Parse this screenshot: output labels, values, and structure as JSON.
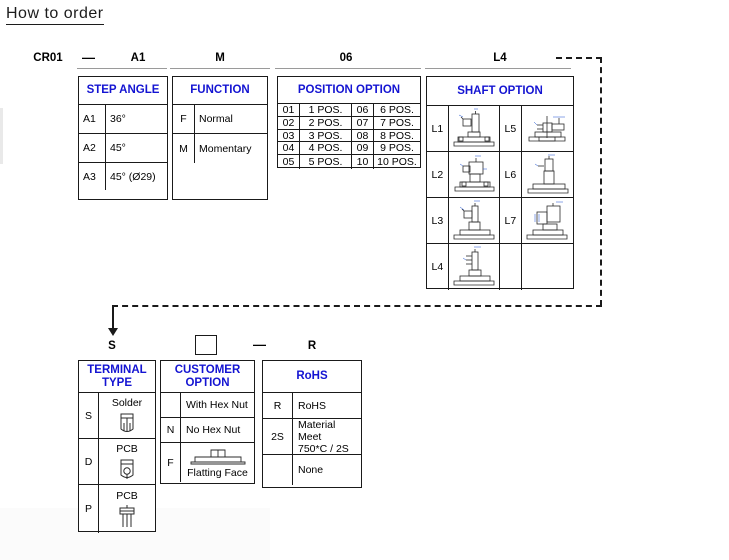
{
  "title": "How to order",
  "part_code": {
    "segments": [
      {
        "name": "series",
        "value": "CR01"
      },
      {
        "name": "step-angle",
        "value": "A1"
      },
      {
        "name": "function",
        "value": "M"
      },
      {
        "name": "position-option",
        "value": "06"
      },
      {
        "name": "shaft-option",
        "value": "L4"
      },
      {
        "name": "terminal-type",
        "value": "S"
      },
      {
        "name": "customer-option",
        "value": ""
      },
      {
        "name": "rohs",
        "value": "R"
      }
    ],
    "separator": "—"
  },
  "tables": {
    "step_angle": {
      "header": "STEP ANGLE",
      "rows": [
        {
          "code": "A1",
          "desc": "36°"
        },
        {
          "code": "A2",
          "desc": "45°"
        },
        {
          "code": "A3",
          "desc": "45° (Ø29)"
        }
      ]
    },
    "function": {
      "header": "FUNCTION",
      "rows": [
        {
          "code": "F",
          "desc": "Normal"
        },
        {
          "code": "M",
          "desc": "Momentary"
        }
      ]
    },
    "position_option": {
      "header": "POSITION OPTION",
      "rows": [
        {
          "code_l": "01",
          "desc_l": "1 POS.",
          "code_r": "06",
          "desc_r": "6 POS."
        },
        {
          "code_l": "02",
          "desc_l": "2 POS.",
          "code_r": "07",
          "desc_r": "7 POS."
        },
        {
          "code_l": "03",
          "desc_l": "3 POS.",
          "code_r": "08",
          "desc_r": "8 POS."
        },
        {
          "code_l": "04",
          "desc_l": "4 POS.",
          "code_r": "09",
          "desc_r": "9 POS."
        },
        {
          "code_l": "05",
          "desc_l": "5 POS.",
          "code_r": "10",
          "desc_r": "10 POS."
        }
      ]
    },
    "shaft_option": {
      "header": "SHAFT OPTION",
      "rows": [
        {
          "code_l": "L1",
          "icon_l": "shaft-drawing-l1",
          "code_r": "L5",
          "icon_r": "shaft-drawing-l5"
        },
        {
          "code_l": "L2",
          "icon_l": "shaft-drawing-l2",
          "code_r": "L6",
          "icon_r": "shaft-drawing-l6"
        },
        {
          "code_l": "L3",
          "icon_l": "shaft-drawing-l3",
          "code_r": "L7",
          "icon_r": "shaft-drawing-l7"
        },
        {
          "code_l": "L4",
          "icon_l": "shaft-drawing-l4",
          "code_r": "",
          "icon_r": ""
        }
      ]
    },
    "terminal_type": {
      "header_line1": "TERMINAL",
      "header_line2": "TYPE",
      "rows": [
        {
          "code": "S",
          "label": "Solder",
          "icon": "solder-terminal-icon"
        },
        {
          "code": "D",
          "label": "PCB",
          "icon": "pcb-terminal-d-icon"
        },
        {
          "code": "P",
          "label": "PCB",
          "icon": "pcb-terminal-p-icon"
        }
      ]
    },
    "customer_option": {
      "header_line1": "CUSTOMER",
      "header_line2": "OPTION",
      "rows": [
        {
          "code": "",
          "desc": "With Hex Nut",
          "icon": ""
        },
        {
          "code": "N",
          "desc": "No Hex Nut",
          "icon": ""
        },
        {
          "code": "F",
          "desc": "Flatting Face",
          "icon": "flatting-face-icon"
        }
      ]
    },
    "rohs": {
      "header": "RoHS",
      "rows": [
        {
          "code": "R",
          "desc": "RoHS"
        },
        {
          "code": "2S",
          "desc": "Material Meet\n750*C / 2S"
        },
        {
          "code": "",
          "desc": "None"
        }
      ]
    }
  },
  "colors": {
    "header_text": "#1414d2",
    "border": "#1a1a1a",
    "text": "#000000",
    "background": "#ffffff"
  }
}
